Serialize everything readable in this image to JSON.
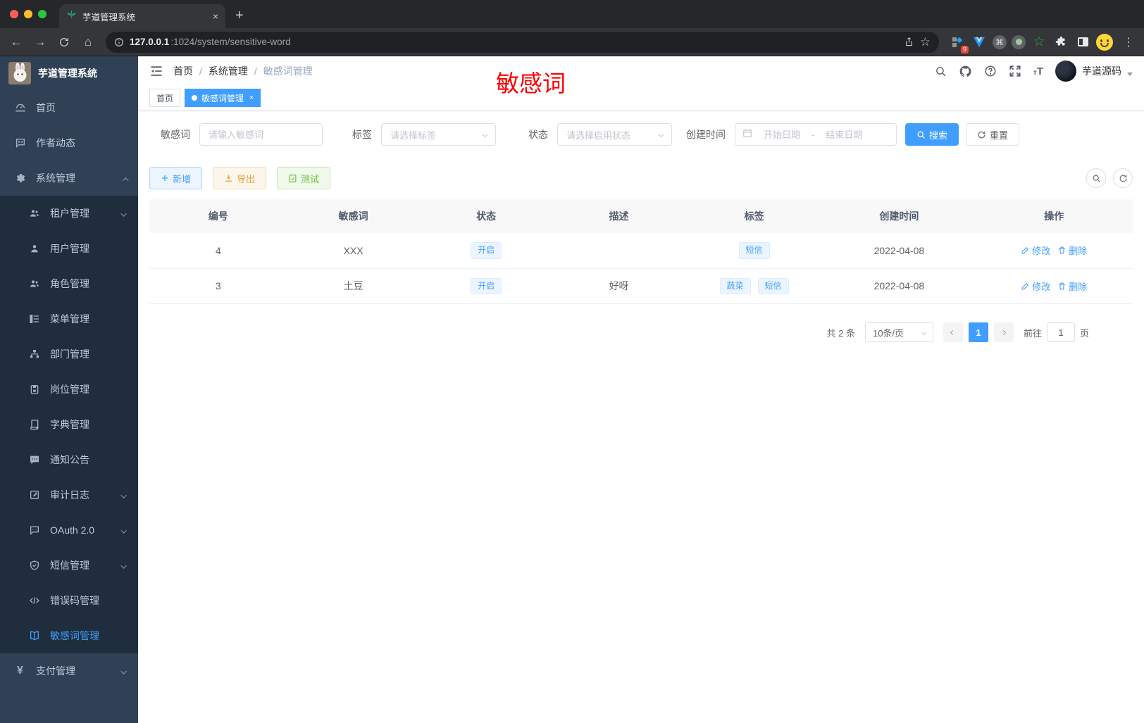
{
  "browser": {
    "tab_title": "芋道管理系统",
    "close_tab": "×",
    "new_tab": "+",
    "url_host": "127.0.0.1",
    "url_path": ":1024/system/sensitive-word",
    "extension_badge": "9",
    "icons": [
      "back-arrow",
      "forward-arrow",
      "reload",
      "home",
      "info",
      "share",
      "star",
      "pinned-extension-grid",
      "vue-devtools",
      "command-circle",
      "recorder-circle",
      "green-star",
      "puzzle",
      "split-view",
      "profile-emoji",
      "kebab-menu"
    ]
  },
  "sidebar": {
    "app_title": "芋道管理系统",
    "items": [
      {
        "label": "首页",
        "icon": "dashboard-icon"
      },
      {
        "label": "作者动态",
        "icon": "chat-icon"
      },
      {
        "label": "系统管理",
        "icon": "gear-icon"
      },
      {
        "label": "租户管理",
        "icon": "users-icon"
      },
      {
        "label": "用户管理",
        "icon": "user-icon"
      },
      {
        "label": "角色管理",
        "icon": "users-icon"
      },
      {
        "label": "菜单管理",
        "icon": "tree-list-icon"
      },
      {
        "label": "部门管理",
        "icon": "org-chart-icon"
      },
      {
        "label": "岗位管理",
        "icon": "id-badge-icon"
      },
      {
        "label": "字典管理",
        "icon": "dictionary-icon"
      },
      {
        "label": "通知公告",
        "icon": "announcement-icon"
      },
      {
        "label": "审计日志",
        "icon": "audit-log-icon"
      },
      {
        "label": "OAuth 2.0",
        "icon": "oauth-chat-icon"
      },
      {
        "label": "短信管理",
        "icon": "shield-icon"
      },
      {
        "label": "错误码管理",
        "icon": "code-icon"
      },
      {
        "label": "敏感词管理",
        "icon": "open-book-icon"
      },
      {
        "label": "支付管理",
        "icon": "yen-icon"
      }
    ]
  },
  "navbar": {
    "breadcrumb": [
      "首页",
      "系统管理",
      "敏感词管理"
    ],
    "separator": "/",
    "user_name": "芋道源码"
  },
  "annotation": "敏感词",
  "page_tabs": [
    {
      "label": "首页"
    },
    {
      "label": "敏感词管理",
      "close": "×"
    }
  ],
  "filters": {
    "word_label": "敏感词",
    "word_placeholder": "请输入敏感词",
    "tag_label": "标签",
    "tag_placeholder": "请选择标签",
    "status_label": "状态",
    "status_placeholder": "请选择启用状态",
    "time_label": "创建时间",
    "start_placeholder": "开始日期",
    "separator": "-",
    "end_placeholder": "结束日期",
    "search_label": "搜索",
    "reset_label": "重置"
  },
  "toolbar": {
    "add_label": "新增",
    "export_label": "导出",
    "test_label": "测试"
  },
  "table": {
    "headers": [
      "编号",
      "敏感词",
      "状态",
      "描述",
      "标签",
      "创建时间",
      "操作"
    ],
    "rows": [
      {
        "id": "4",
        "word": "XXX",
        "status": "开启",
        "description": "",
        "tags": [
          "短信"
        ],
        "create_time": "2022-04-08"
      },
      {
        "id": "3",
        "word": "土豆",
        "status": "开启",
        "description": "好呀",
        "tags": [
          "蔬菜",
          "短信"
        ],
        "create_time": "2022-04-08"
      }
    ],
    "edit_label": "修改",
    "delete_label": "删除"
  },
  "pagination": {
    "total": "共 2 条",
    "page_size": "10条/页",
    "current_page": "1",
    "goto_label": "前往",
    "goto_value": "1",
    "unit_label": "页"
  },
  "colors": {
    "accent": "#409eff",
    "annotation_red": "#fb0000",
    "sidebar_bg": "#304156",
    "submenu_bg": "#1f2d3d",
    "tag_bg": "#ecf5ff",
    "tag_text": "#409eff",
    "warn": "#e6a23c",
    "success": "#67c23a"
  }
}
